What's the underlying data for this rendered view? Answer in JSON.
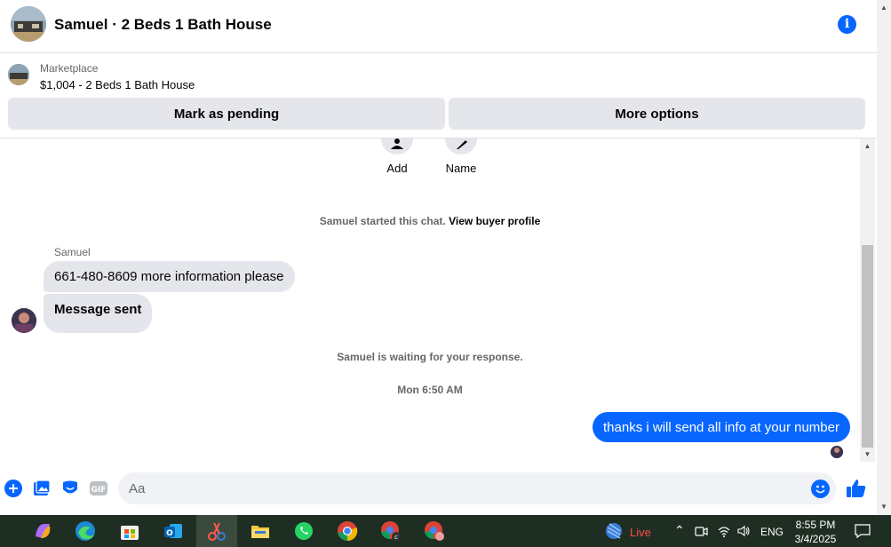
{
  "header": {
    "title": "Samuel · 2 Beds 1 Bath House"
  },
  "marketplace": {
    "label": "Marketplace",
    "item": "$1,004 - 2 Beds 1 Bath House",
    "mark_pending_label": "Mark as pending",
    "more_options_label": "More options"
  },
  "chat": {
    "add_label": "Add",
    "name_label": "Name",
    "started_text": "Samuel started this chat.",
    "view_profile_link": "View buyer profile",
    "sender": "Samuel",
    "messages_in": [
      "661-480-8609 more information please",
      "Message sent"
    ],
    "waiting_text": "Samuel is waiting for your response.",
    "timestamp": "Mon 6:50 AM",
    "message_out": "thanks i will send all info at your number"
  },
  "composer": {
    "placeholder": "Aa",
    "gif_label": "GIF"
  },
  "taskbar": {
    "live_label": "Live",
    "lang": "ENG",
    "time": "8:55 PM",
    "date": "3/4/2025"
  },
  "colors": {
    "accent": "#0866ff",
    "bubble_in": "#e4e6eb",
    "taskbar_bg": "#1f2e22"
  }
}
